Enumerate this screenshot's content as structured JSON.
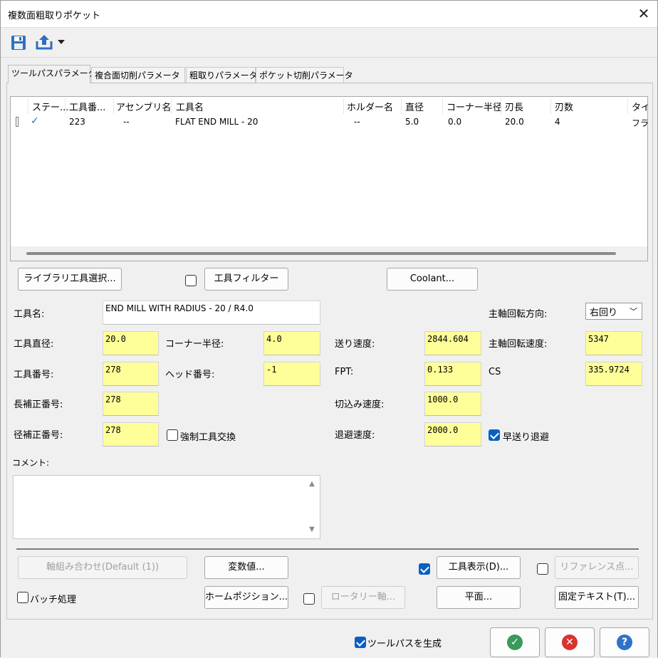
{
  "window": {
    "title": "複数面粗取りポケット"
  },
  "tabs": [
    "ツールパスパラメータ",
    "複合面切削パラメータ",
    "粗取りパラメータ",
    "ポケット切削パラメータ"
  ],
  "tool_table": {
    "columns": [
      "ステー...",
      "工具番...",
      "アセンブリ名",
      "工具名",
      "ホルダー名",
      "直径",
      "コーナー半径",
      "刃長",
      "刃数",
      "タイプ"
    ],
    "row": {
      "status": "✓",
      "tool_number": "223",
      "assembly": "--",
      "tool_name": "FLAT END MILL - 20",
      "holder": "--",
      "diameter": "5.0",
      "corner_radius": "0.0",
      "flute_length": "20.0",
      "flutes": "4",
      "type": "フラ"
    }
  },
  "buttons": {
    "library": "ライブラリ工具選択...",
    "filter": "工具フィルター",
    "coolant": "Coolant...",
    "axis_combo": "軸組み合わせ(Default (1))",
    "variables": "変数値...",
    "tool_display": "工具表示(D)...",
    "reference_points": "リファレンス点...",
    "home_position": "ホームポジション...",
    "rotary_axis": "ロータリー軸...",
    "planes": "平面...",
    "fixed_text": "固定テキスト(T)..."
  },
  "fields": {
    "tool_name_label": "工具名:",
    "tool_name": "END MILL WITH RADIUS - 20 / R4.0",
    "tool_diameter_label": "工具直径:",
    "tool_diameter": "20.0",
    "corner_radius_label": "コーナー半径:",
    "corner_radius": "4.0",
    "tool_number_label": "工具番号:",
    "tool_number": "278",
    "head_number_label": "ヘッド番号:",
    "head_number": "-1",
    "length_offset_label": "長補正番号:",
    "length_offset": "278",
    "dia_offset_label": "径補正番号:",
    "dia_offset": "278",
    "force_tool_change_label": "強制工具交換",
    "feed_rate_label": "送り速度:",
    "feed_rate": "2844.604",
    "fpt_label": "FPT:",
    "fpt": "0.133",
    "plunge_rate_label": "切込み速度:",
    "plunge_rate": "1000.0",
    "retract_rate_label": "退避速度:",
    "retract_rate": "2000.0",
    "rapid_retract_label": "早送り退避",
    "spindle_dir_label": "主軸回転方向:",
    "spindle_dir": "右回り",
    "spindle_speed_label": "主軸回転速度:",
    "spindle_speed": "5347",
    "cs_label": "CS",
    "cs": "335.9724",
    "comment_label": "コメント:"
  },
  "checks": {
    "filter": false,
    "force_tool_change": false,
    "rapid_retract": true,
    "tool_display": true,
    "reference_points": false,
    "batch": false,
    "rotary": false,
    "generate_toolpath": true
  },
  "labels": {
    "batch": "バッチ処理",
    "generate_toolpath": "ツールパスを生成"
  },
  "colors": {
    "highlight_field": "#ffff99",
    "ok_green": "#3a9a5a",
    "cancel_red": "#d9332e",
    "help_blue": "#2f72c8",
    "check_blue": "#0a5fc2"
  }
}
